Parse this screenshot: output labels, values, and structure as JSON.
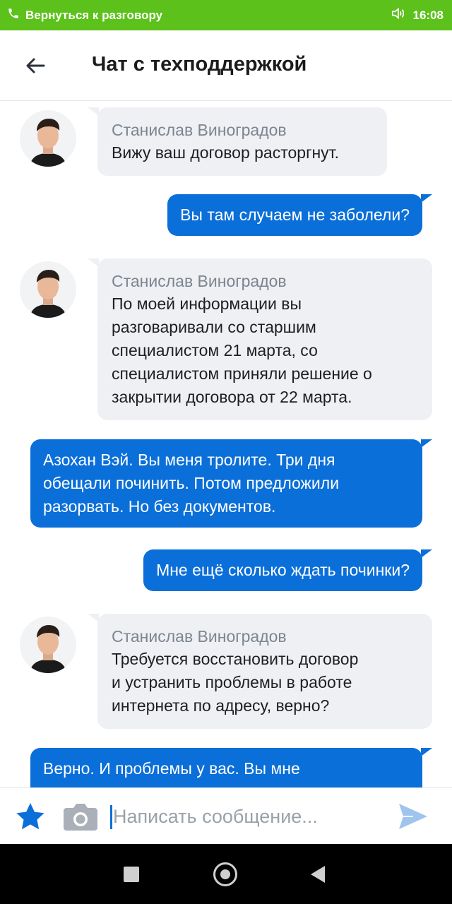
{
  "status_bar": {
    "call_return_label": "Вернуться к разговору",
    "time": "16:08",
    "call_icon": "phone-icon",
    "speaker_icon": "speaker-icon",
    "color": "#5cc11b"
  },
  "header": {
    "title": "Чат с техподдержкой",
    "back_icon": "arrow-left-icon"
  },
  "messages": [
    {
      "direction": "incoming",
      "sender": "Станислав Виноградов",
      "text": "Вижу ваш договор расторгнут."
    },
    {
      "direction": "outgoing",
      "text": "Вы там случаем не заболели?"
    },
    {
      "direction": "incoming",
      "sender": "Станислав Виноградов",
      "lines": [
        "По моей информации вы",
        "разговаривали со старшим",
        "специалистом 21 марта, со",
        "специалистом приняли решение о",
        "закрытии договора от 22 марта."
      ]
    },
    {
      "direction": "outgoing",
      "lines": [
        "Азохан Вэй. Вы меня тролите. Три дня",
        "обещали починить. Потом предложили",
        "разорвать. Но без документов."
      ]
    },
    {
      "direction": "outgoing",
      "text": "Мне ещё сколько ждать починки?"
    },
    {
      "direction": "incoming",
      "sender": "Станислав Виноградов",
      "lines": [
        "Требуется восстановить договор",
        "и устранить проблемы в работе",
        "интернета по адресу, верно?"
      ]
    },
    {
      "direction": "outgoing",
      "text": "Верно. И проблемы у вас. Вы мне"
    }
  ],
  "input_bar": {
    "placeholder": "Написать сообщение...",
    "star_icon": "star-icon",
    "camera_icon": "camera-icon",
    "send_icon": "send-icon"
  },
  "colors": {
    "outgoing_bubble": "#0b6fd9",
    "incoming_bubble": "#eef0f3",
    "sender_name": "#7c8590"
  }
}
